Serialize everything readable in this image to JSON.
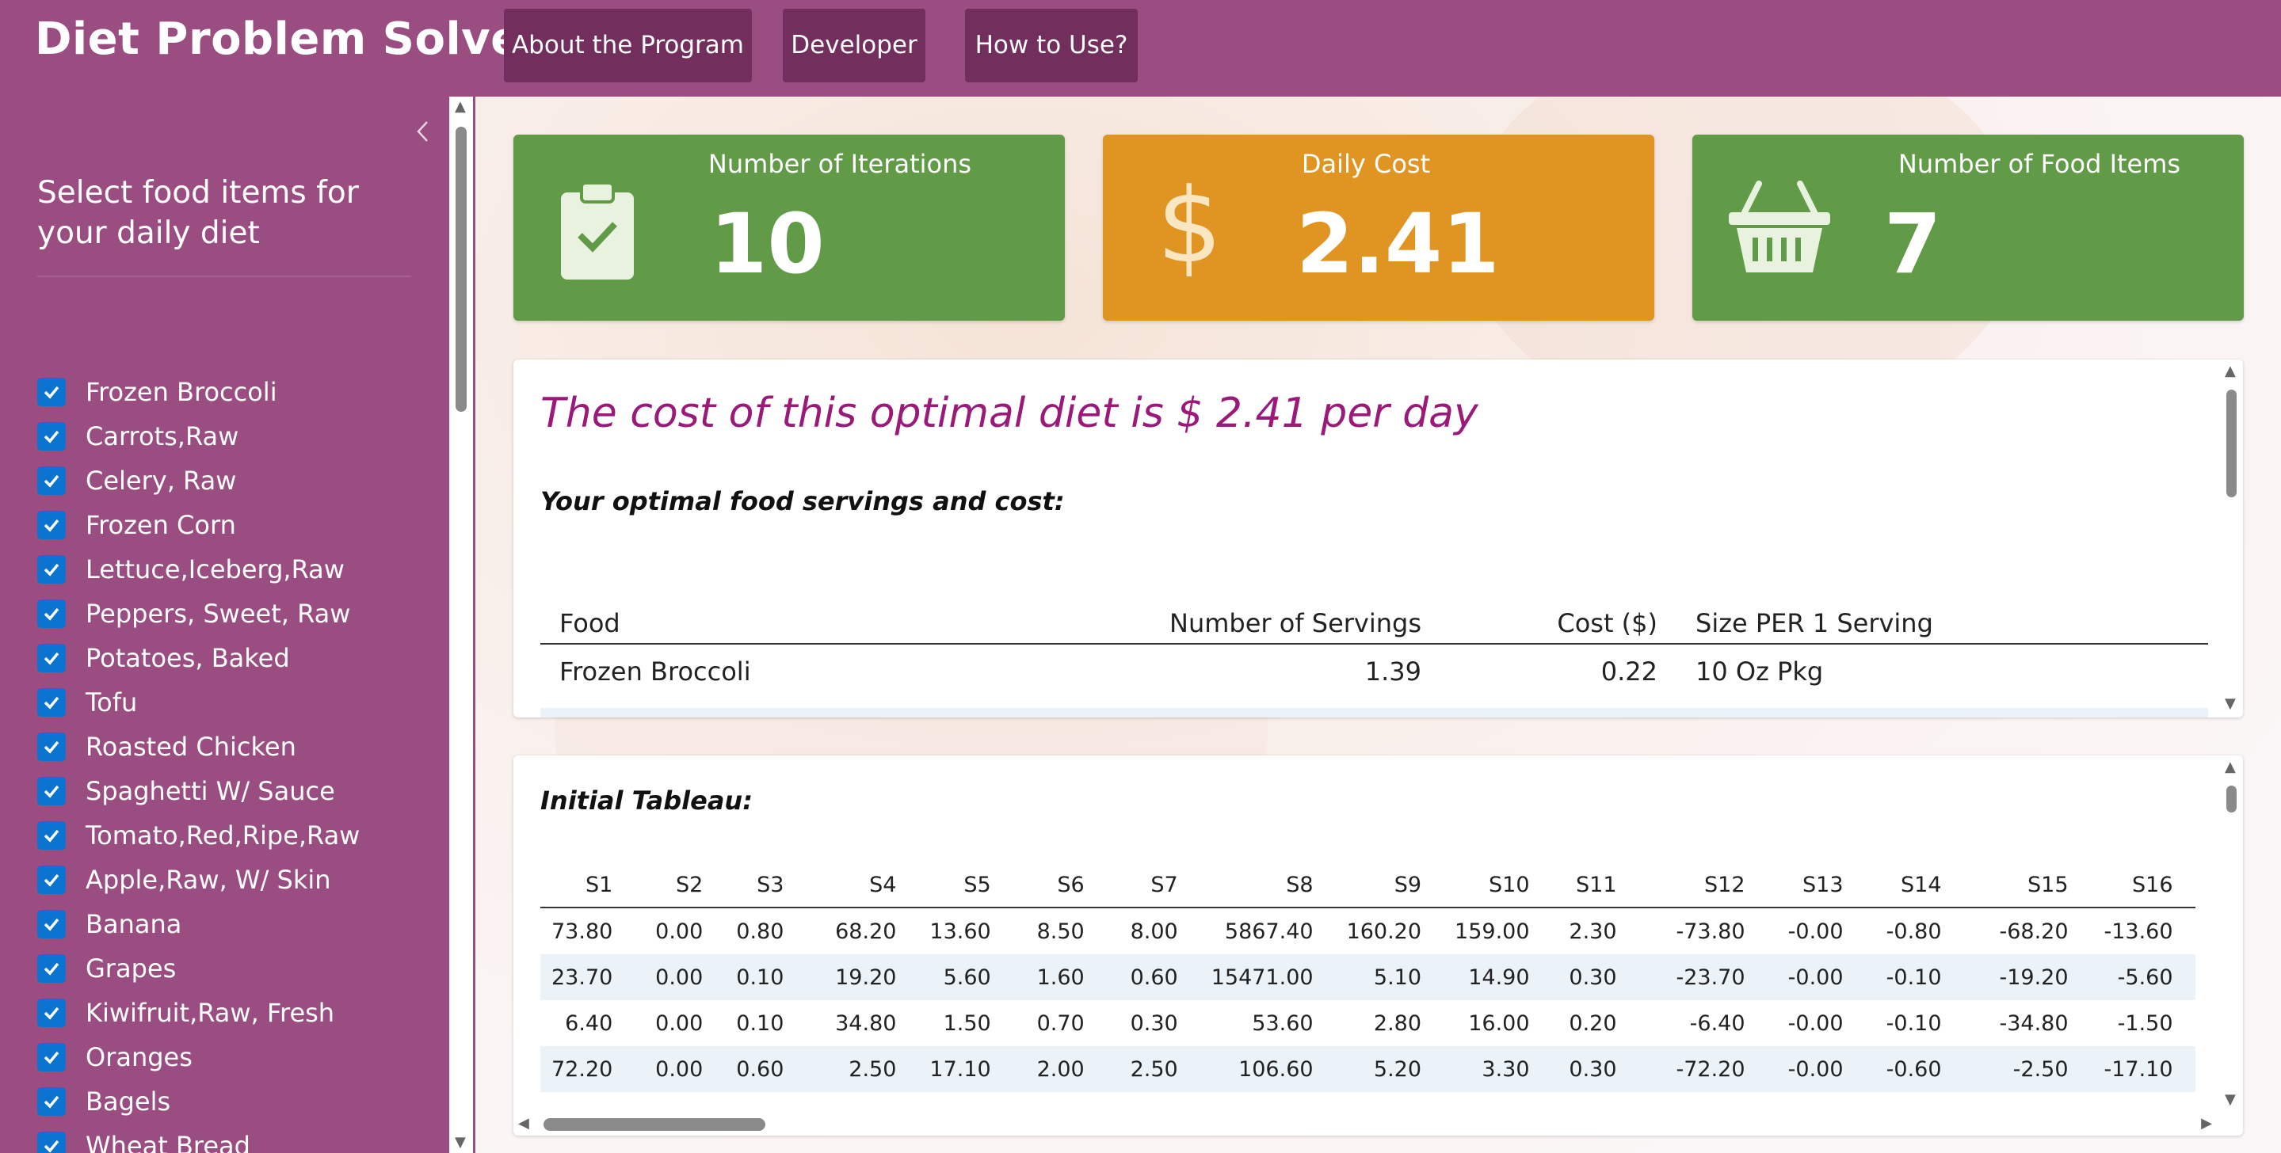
{
  "app": {
    "title": "Diet Problem Solver"
  },
  "nav": [
    {
      "label": "About the Program"
    },
    {
      "label": "Developer"
    },
    {
      "label": "How to Use?"
    }
  ],
  "sidebar": {
    "collapse_icon": "chevron-left-icon",
    "title": "Select food items for your daily diet",
    "foods": [
      {
        "label": "Frozen Broccoli",
        "checked": true
      },
      {
        "label": "Carrots,Raw",
        "checked": true
      },
      {
        "label": "Celery, Raw",
        "checked": true
      },
      {
        "label": "Frozen Corn",
        "checked": true
      },
      {
        "label": "Lettuce,Iceberg,Raw",
        "checked": true
      },
      {
        "label": "Peppers, Sweet, Raw",
        "checked": true
      },
      {
        "label": "Potatoes, Baked",
        "checked": true
      },
      {
        "label": "Tofu",
        "checked": true
      },
      {
        "label": "Roasted Chicken",
        "checked": true
      },
      {
        "label": "Spaghetti W/ Sauce",
        "checked": true
      },
      {
        "label": "Tomato,Red,Ripe,Raw",
        "checked": true
      },
      {
        "label": "Apple,Raw, W/ Skin",
        "checked": true
      },
      {
        "label": "Banana",
        "checked": true
      },
      {
        "label": "Grapes",
        "checked": true
      },
      {
        "label": "Kiwifruit,Raw, Fresh",
        "checked": true
      },
      {
        "label": "Oranges",
        "checked": true
      },
      {
        "label": "Bagels",
        "checked": true
      },
      {
        "label": "Wheat Bread",
        "checked": true
      }
    ]
  },
  "value_boxes": [
    {
      "title": "Number of Iterations",
      "value": "10",
      "icon": "clipboard-check-icon",
      "color": "#629b48"
    },
    {
      "title": "Daily Cost",
      "value": "2.41",
      "icon": "dollar-icon",
      "color": "#e09421"
    },
    {
      "title": "Number of Food Items",
      "value": "7",
      "icon": "basket-icon",
      "color": "#629b48"
    }
  ],
  "result": {
    "headline": "The cost of this optimal diet is $ 2.41 per day",
    "subtitle": "Your optimal food servings and cost:",
    "columns": [
      "Food",
      "Number of Servings",
      "Cost ($)",
      "Size PER 1 Serving"
    ],
    "rows": [
      [
        "Frozen Broccoli",
        "1.39",
        "0.22",
        "10 Oz Pkg"
      ]
    ]
  },
  "tableau": {
    "title": "Initial Tableau:",
    "columns": [
      "S1",
      "S2",
      "S3",
      "S4",
      "S5",
      "S6",
      "S7",
      "S8",
      "S9",
      "S10",
      "S11",
      "S12",
      "S13",
      "S14",
      "S15",
      "S16"
    ],
    "rows": [
      [
        "73.80",
        "0.00",
        "0.80",
        "68.20",
        "13.60",
        "8.50",
        "8.00",
        "5867.40",
        "160.20",
        "159.00",
        "2.30",
        "-73.80",
        "-0.00",
        "-0.80",
        "-68.20",
        "-13.60"
      ],
      [
        "23.70",
        "0.00",
        "0.10",
        "19.20",
        "5.60",
        "1.60",
        "0.60",
        "15471.00",
        "5.10",
        "14.90",
        "0.30",
        "-23.70",
        "-0.00",
        "-0.10",
        "-19.20",
        "-5.60"
      ],
      [
        "6.40",
        "0.00",
        "0.10",
        "34.80",
        "1.50",
        "0.70",
        "0.30",
        "53.60",
        "2.80",
        "16.00",
        "0.20",
        "-6.40",
        "-0.00",
        "-0.10",
        "-34.80",
        "-1.50"
      ],
      [
        "72.20",
        "0.00",
        "0.60",
        "2.50",
        "17.10",
        "2.00",
        "2.50",
        "106.60",
        "5.20",
        "3.30",
        "0.30",
        "-72.20",
        "-0.00",
        "-0.60",
        "-2.50",
        "-17.10"
      ]
    ]
  }
}
